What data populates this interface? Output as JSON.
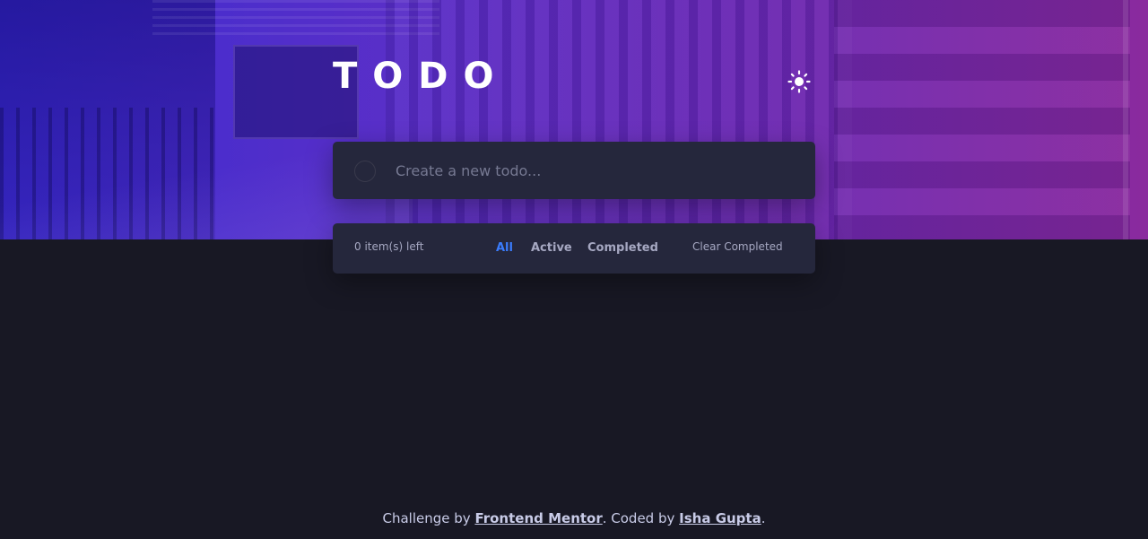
{
  "header": {
    "title": "TODO",
    "theme_toggle_icon": "sun-icon"
  },
  "new_todo": {
    "placeholder": "Create a new todo..."
  },
  "footer_bar": {
    "items_left": "0 item(s) left",
    "filters": [
      "All",
      "Active",
      "Completed"
    ],
    "selected_filter": "All",
    "clear_label": "Clear Completed"
  },
  "attribution": {
    "prefix": "Challenge by ",
    "link1": "Frontend Mentor",
    "middle": ". Coded by ",
    "link2": "Isha Gupta",
    "suffix": "."
  },
  "colors": {
    "background": "#181824",
    "card": "#25273c",
    "accent": "#3a7cfd",
    "text_muted": "#a6a8c2",
    "gradient_start": "#3a2bd0",
    "gradient_end": "#8a2a9e"
  }
}
